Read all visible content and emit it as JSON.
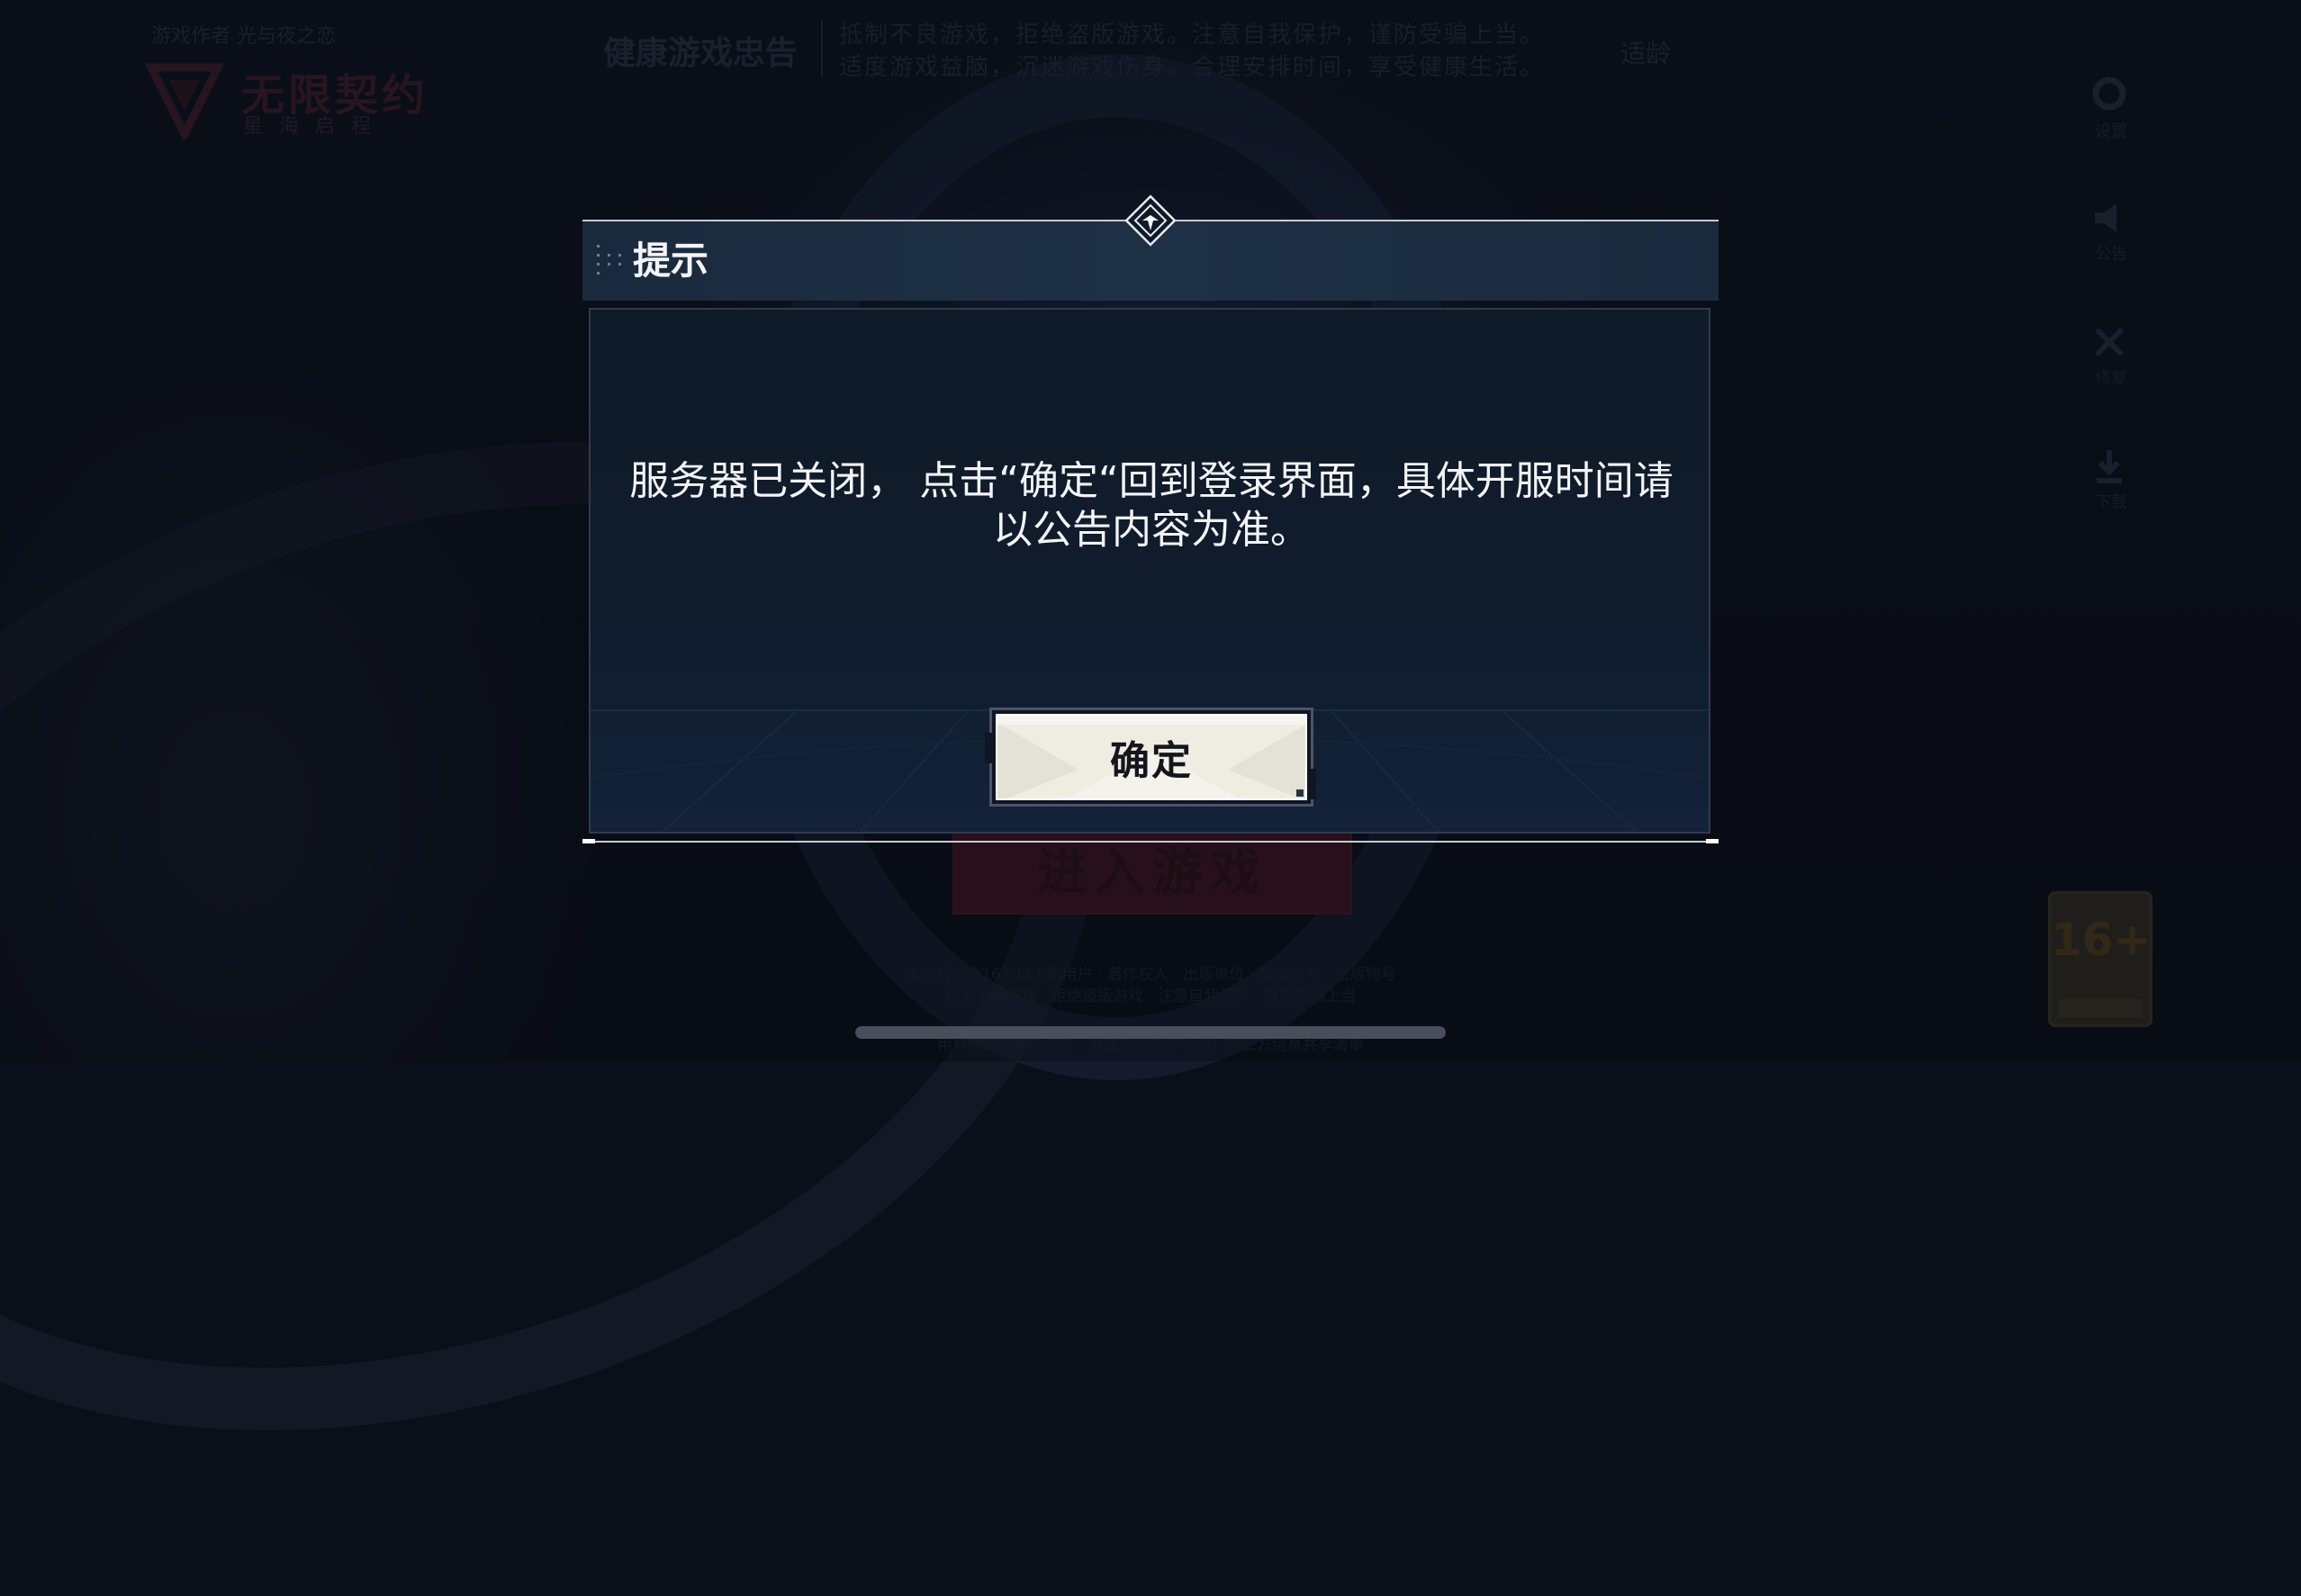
{
  "background": {
    "logo_top_text": "游戏作者 光与夜之恋",
    "logo_title": "无限契约",
    "logo_subtitle": "星海启程",
    "notice_title": "健康游戏忠告",
    "notice_lines": [
      "抵制不良游戏，拒绝盗版游戏。注意自我保护，谨防受骗上当。",
      "适度游戏益脑，沉迷游戏伤身。合理安排时间，享受健康生活。"
    ],
    "age_link": "适龄",
    "side_menu": [
      {
        "icon": "settings-icon",
        "label": "设置"
      },
      {
        "icon": "announcement-icon",
        "label": "公告"
      },
      {
        "icon": "repair-icon",
        "label": "修复"
      },
      {
        "icon": "download-icon",
        "label": "下载"
      }
    ],
    "enter_button": "进入游戏",
    "footer_lines": [
      "本游戏适合16岁以上的用户 · 著作权人 · 出版单位 · 审批文号 · 出版物号",
      "抵制不良游戏 · 拒绝盗版游戏 · 注意自我保护 · 谨防受骗上当",
      "用户协议 · 隐私政策 · 儿童隐私保护指引 · 第三方信息共享清单"
    ],
    "age_rating": "16+"
  },
  "dialog": {
    "title": "提示",
    "message_line1": "服务器已关闭， 点击“确定“回到登录界面，具体开服时间请",
    "message_line2": "以公告内容为准。",
    "confirm_label": "确定"
  },
  "colors": {
    "header_bg": "#1e3046",
    "body_bg": "#101c2c",
    "button_bg": "#efece2",
    "text": "#f3f4f6"
  }
}
